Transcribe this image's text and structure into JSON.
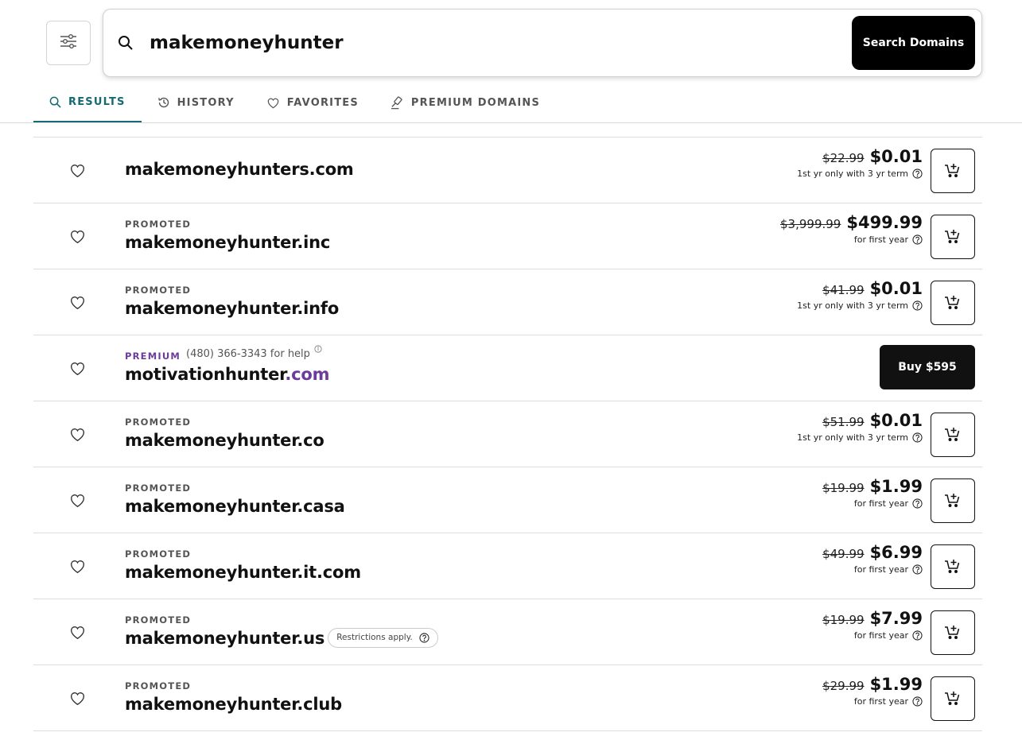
{
  "search": {
    "value": "makemoneyhunter",
    "button_label": "Search Domains"
  },
  "tabs": [
    {
      "label": "RESULTS",
      "icon": "search-icon",
      "active": true
    },
    {
      "label": "HISTORY",
      "icon": "history-icon",
      "active": false
    },
    {
      "label": "FAVORITES",
      "icon": "heart-icon",
      "active": false
    },
    {
      "label": "PREMIUM DOMAINS",
      "icon": "gavel-icon",
      "active": false
    }
  ],
  "colors": {
    "accent": "#146b72",
    "premium": "#6d3b9c",
    "button": "#000000"
  },
  "results": [
    {
      "tag": "",
      "domain": "makemoneyhunters.com",
      "old_price": "$22.99",
      "price": "$0.01",
      "term": "1st yr only with 3 yr term"
    },
    {
      "tag": "PROMOTED",
      "domain": "makemoneyhunter.inc",
      "old_price": "$3,999.99",
      "price": "$499.99",
      "term": "for first year"
    },
    {
      "tag": "PROMOTED",
      "domain": "makemoneyhunter.info",
      "old_price": "$41.99",
      "price": "$0.01",
      "term": "1st yr only with 3 yr term"
    },
    {
      "tag": "PREMIUM",
      "help": "(480) 366-3343 for help",
      "domain_base": "motivationhunter",
      "domain_tld": ".com",
      "buy_label": "Buy $595"
    },
    {
      "tag": "PROMOTED",
      "domain": "makemoneyhunter.co",
      "old_price": "$51.99",
      "price": "$0.01",
      "term": "1st yr only with 3 yr term"
    },
    {
      "tag": "PROMOTED",
      "domain": "makemoneyhunter.casa",
      "old_price": "$19.99",
      "price": "$1.99",
      "term": "for first year"
    },
    {
      "tag": "PROMOTED",
      "domain": "makemoneyhunter.it.com",
      "old_price": "$49.99",
      "price": "$6.99",
      "term": "for first year"
    },
    {
      "tag": "PROMOTED",
      "domain": "makemoneyhunter.us",
      "badge": "Restrictions apply.",
      "old_price": "$19.99",
      "price": "$7.99",
      "term": "for first year"
    },
    {
      "tag": "PROMOTED",
      "domain": "makemoneyhunter.club",
      "old_price": "$29.99",
      "price": "$1.99",
      "term": "for first year"
    }
  ]
}
